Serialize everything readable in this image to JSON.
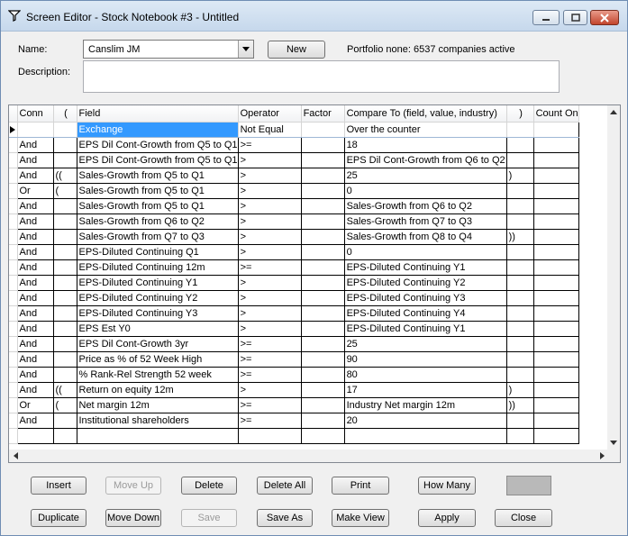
{
  "window": {
    "title": "Screen Editor - Stock Notebook #3 - Untitled"
  },
  "form": {
    "name_label": "Name:",
    "name_value": "Canslim JM",
    "new_label": "New",
    "portfolio_text": "Portfolio none: 6537 companies active",
    "description_label": "Description:",
    "description_value": ""
  },
  "grid": {
    "columns": [
      "Conn",
      "(",
      "Field",
      "Operator",
      "Factor",
      "Compare To (field, value, industry)",
      ")",
      "Count On"
    ],
    "rows": [
      {
        "conn": "",
        "open": "",
        "field": "Exchange",
        "operator": "Not Equal",
        "factor": "",
        "compare": "Over the counter",
        "close": "",
        "count": ""
      },
      {
        "conn": "And",
        "open": "",
        "field": "EPS Dil Cont-Growth from Q5 to Q1",
        "operator": ">=",
        "factor": "",
        "compare": "18",
        "close": "",
        "count": ""
      },
      {
        "conn": "And",
        "open": "",
        "field": "EPS Dil Cont-Growth from Q5 to Q1",
        "operator": ">",
        "factor": "",
        "compare": "EPS Dil Cont-Growth from Q6 to Q2",
        "close": "",
        "count": ""
      },
      {
        "conn": "And",
        "open": "((",
        "field": "Sales-Growth from Q5 to Q1",
        "operator": ">",
        "factor": "",
        "compare": "25",
        "close": ")",
        "count": ""
      },
      {
        "conn": "Or",
        "open": "(",
        "field": "Sales-Growth from Q5 to Q1",
        "operator": ">",
        "factor": "",
        "compare": "0",
        "close": "",
        "count": ""
      },
      {
        "conn": "And",
        "open": "",
        "field": "Sales-Growth from Q5 to Q1",
        "operator": ">",
        "factor": "",
        "compare": "Sales-Growth from Q6 to Q2",
        "close": "",
        "count": ""
      },
      {
        "conn": "And",
        "open": "",
        "field": "Sales-Growth from Q6 to Q2",
        "operator": ">",
        "factor": "",
        "compare": "Sales-Growth from Q7 to Q3",
        "close": "",
        "count": ""
      },
      {
        "conn": "And",
        "open": "",
        "field": "Sales-Growth from Q7 to Q3",
        "operator": ">",
        "factor": "",
        "compare": "Sales-Growth from Q8 to Q4",
        "close": "))",
        "count": ""
      },
      {
        "conn": "And",
        "open": "",
        "field": "EPS-Diluted Continuing Q1",
        "operator": ">",
        "factor": "",
        "compare": "0",
        "close": "",
        "count": ""
      },
      {
        "conn": "And",
        "open": "",
        "field": "EPS-Diluted Continuing 12m",
        "operator": ">=",
        "factor": "",
        "compare": "EPS-Diluted Continuing Y1",
        "close": "",
        "count": ""
      },
      {
        "conn": "And",
        "open": "",
        "field": "EPS-Diluted Continuing Y1",
        "operator": ">",
        "factor": "",
        "compare": "EPS-Diluted Continuing Y2",
        "close": "",
        "count": ""
      },
      {
        "conn": "And",
        "open": "",
        "field": "EPS-Diluted Continuing Y2",
        "operator": ">",
        "factor": "",
        "compare": "EPS-Diluted Continuing Y3",
        "close": "",
        "count": ""
      },
      {
        "conn": "And",
        "open": "",
        "field": "EPS-Diluted Continuing Y3",
        "operator": ">",
        "factor": "",
        "compare": "EPS-Diluted Continuing Y4",
        "close": "",
        "count": ""
      },
      {
        "conn": "And",
        "open": "",
        "field": "EPS Est Y0",
        "operator": ">",
        "factor": "",
        "compare": "EPS-Diluted Continuing Y1",
        "close": "",
        "count": ""
      },
      {
        "conn": "And",
        "open": "",
        "field": "EPS Dil Cont-Growth 3yr",
        "operator": ">=",
        "factor": "",
        "compare": "25",
        "close": "",
        "count": ""
      },
      {
        "conn": "And",
        "open": "",
        "field": "Price as % of 52 Week High",
        "operator": ">=",
        "factor": "",
        "compare": "90",
        "close": "",
        "count": ""
      },
      {
        "conn": "And",
        "open": "",
        "field": "% Rank-Rel Strength 52 week",
        "operator": ">=",
        "factor": "",
        "compare": "80",
        "close": "",
        "count": ""
      },
      {
        "conn": "And",
        "open": "((",
        "field": "Return on equity 12m",
        "operator": ">",
        "factor": "",
        "compare": "17",
        "close": ")",
        "count": ""
      },
      {
        "conn": "Or",
        "open": "(",
        "field": "Net margin 12m",
        "operator": ">=",
        "factor": "",
        "compare": "Industry Net margin 12m",
        "close": "))",
        "count": ""
      },
      {
        "conn": "And",
        "open": "",
        "field": "Institutional shareholders",
        "operator": ">=",
        "factor": "",
        "compare": "20",
        "close": "",
        "count": ""
      },
      {
        "conn": "",
        "open": "",
        "field": "",
        "operator": "",
        "factor": "",
        "compare": "",
        "close": "",
        "count": ""
      }
    ]
  },
  "buttons": {
    "insert": "Insert",
    "move_up": "Move Up",
    "delete": "Delete",
    "delete_all": "Delete All",
    "print": "Print",
    "how_many": "How Many",
    "duplicate": "Duplicate",
    "move_down": "Move Down",
    "save": "Save",
    "save_as": "Save As",
    "make_view": "Make View",
    "apply": "Apply",
    "close": "Close"
  }
}
